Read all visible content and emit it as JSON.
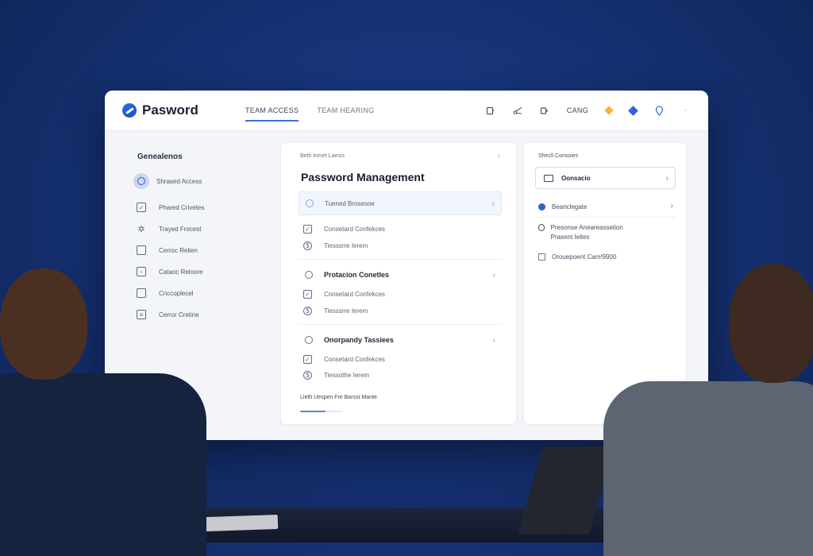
{
  "app": {
    "name": "Pasword",
    "nav_tabs": [
      "TEAM ACCESS",
      "TEAM HEARING"
    ],
    "top_text": "CANG"
  },
  "sidebar": {
    "title": "Genealenos",
    "items": [
      {
        "label": "Shrased Access",
        "icon": "shield-icon",
        "active": true
      },
      {
        "label": "Phared Crivetes",
        "icon": "checkbox-icon"
      },
      {
        "label": "Trayed Frocest",
        "icon": "sparkle-icon"
      },
      {
        "label": "Cerroc Relien",
        "icon": "card-icon"
      },
      {
        "label": "Cataoc Reloore",
        "icon": "lock-icon"
      },
      {
        "label": "Cnccoplecel",
        "icon": "folder-icon"
      },
      {
        "label": "Cerror Cretine",
        "icon": "document-icon"
      }
    ]
  },
  "main": {
    "breadcrumb": "Beth Inmet Laesis",
    "title": "Password Management",
    "sections": [
      {
        "label": "Tuened Brosesoe",
        "highlight": true,
        "sub": [
          {
            "label": "Consetard Confekces",
            "icon": "checkbox-icon"
          },
          {
            "label": "Tiesssrre Ierem",
            "icon": "dollar-icon"
          }
        ]
      },
      {
        "label": "Protacion Conetles",
        "highlight": false,
        "sub": [
          {
            "label": "Consetard Confekces",
            "icon": "checkbox-icon"
          },
          {
            "label": "Tiesssrre Ierem",
            "icon": "dollar-icon"
          }
        ]
      },
      {
        "label": "Onorpandy Tassiees",
        "highlight": false,
        "sub": [
          {
            "label": "Consetard Confekces",
            "icon": "checkbox-icon"
          },
          {
            "label": "Tiessothe Ierem",
            "icon": "dollar-icon"
          }
        ]
      }
    ],
    "footnote": "Lieth Uespen Fre Barsst Mante",
    "progress": 0.6
  },
  "right_panel": {
    "title": "Shecll Consoies",
    "primary": "Oonsacio",
    "items": [
      {
        "label": "Beanclegate",
        "icon": "blue-dot-icon"
      },
      {
        "label": "Presonse Aneareassetion Prasent Ieltes",
        "icon": "info-icon"
      },
      {
        "label": "Orouepoent Cam!9900",
        "icon": "folder-icon"
      }
    ]
  },
  "colors": {
    "accent": "#3a6fd8",
    "background": "#163274"
  }
}
